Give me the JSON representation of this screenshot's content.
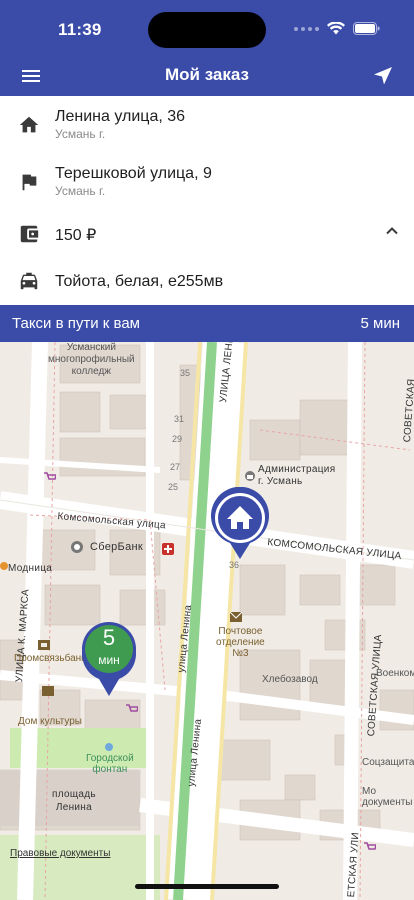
{
  "status": {
    "time": "11:39"
  },
  "header": {
    "title": "Мой заказ"
  },
  "order": {
    "from": {
      "street": "Ленина улица, 36",
      "city": "Усмань г."
    },
    "to": {
      "street": "Терешковой улица, 9",
      "city": "Усмань г."
    },
    "price": "150 ₽",
    "car": "Тойота, белая, е255мв"
  },
  "trip": {
    "message": "Такси в пути к вам",
    "eta": "5 мин"
  },
  "taxi_marker": {
    "minutes": "5",
    "unit": "мин"
  },
  "map": {
    "labels": {
      "college": "Усманский\nмногопрофильный\nколледж",
      "komsomolskaya_left": "Комсомольская улица",
      "komsomolskaya_right": "КОМСОМОЛЬСКАЯ УЛИЦА",
      "lenina_vertical_top": "УЛИЦА ЛЕНИНА",
      "lenina_vertical_mid": "улица Ленина",
      "lenina_vertical_low": "улица Ленина",
      "administration": "Администрация\nг. Усмань",
      "sberbank": "СберБанк",
      "modnitsa": "Модница",
      "marksa": "УЛИЦА К. МАРКСА",
      "post": "Почтовое\nотделение\n№3",
      "khlebozavod": "Хлебозавод",
      "promsvyazbank": "Промсвязьбанк",
      "dom_kultury": "Дом культуры",
      "fountain": "Городской\nфонтан",
      "square": "площадь\nЛенина",
      "sovetskaya": "СОВЕТСКАЯ УЛИЦА",
      "sovetskaya_top": "СОВЕТСКАЯ",
      "sovetskaya_bottom": "ЕТСКАЯ УЛИ",
      "voenkomat": "Военкомат",
      "sotszashchita": "Соцзащита",
      "museum": "Мо\nдокументы",
      "n35": "35",
      "n31": "31",
      "n29": "29",
      "n27": "27",
      "n25": "25",
      "n36": "36"
    }
  },
  "footer": {
    "legal": "Правовые документы"
  },
  "colors": {
    "primary": "#3a4ba8",
    "taxi_green": "#3e9b4f",
    "road_green": "#8ed28e"
  }
}
